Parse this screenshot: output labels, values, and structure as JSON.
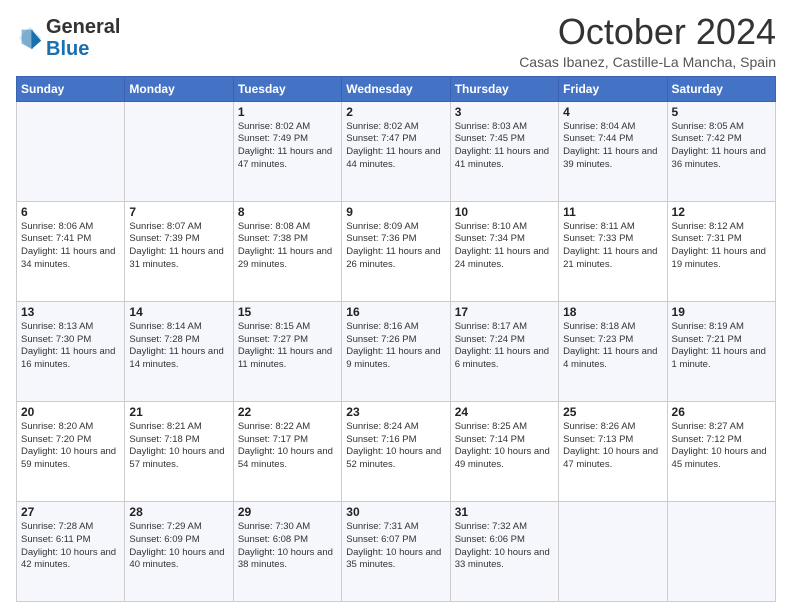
{
  "logo": {
    "line1": "General",
    "line2": "Blue"
  },
  "header": {
    "month": "October 2024",
    "location": "Casas Ibanez, Castille-La Mancha, Spain"
  },
  "weekdays": [
    "Sunday",
    "Monday",
    "Tuesday",
    "Wednesday",
    "Thursday",
    "Friday",
    "Saturday"
  ],
  "weeks": [
    [
      {
        "day": "",
        "sunrise": "",
        "sunset": "",
        "daylight": ""
      },
      {
        "day": "",
        "sunrise": "",
        "sunset": "",
        "daylight": ""
      },
      {
        "day": "1",
        "sunrise": "Sunrise: 8:02 AM",
        "sunset": "Sunset: 7:49 PM",
        "daylight": "Daylight: 11 hours and 47 minutes."
      },
      {
        "day": "2",
        "sunrise": "Sunrise: 8:02 AM",
        "sunset": "Sunset: 7:47 PM",
        "daylight": "Daylight: 11 hours and 44 minutes."
      },
      {
        "day": "3",
        "sunrise": "Sunrise: 8:03 AM",
        "sunset": "Sunset: 7:45 PM",
        "daylight": "Daylight: 11 hours and 41 minutes."
      },
      {
        "day": "4",
        "sunrise": "Sunrise: 8:04 AM",
        "sunset": "Sunset: 7:44 PM",
        "daylight": "Daylight: 11 hours and 39 minutes."
      },
      {
        "day": "5",
        "sunrise": "Sunrise: 8:05 AM",
        "sunset": "Sunset: 7:42 PM",
        "daylight": "Daylight: 11 hours and 36 minutes."
      }
    ],
    [
      {
        "day": "6",
        "sunrise": "Sunrise: 8:06 AM",
        "sunset": "Sunset: 7:41 PM",
        "daylight": "Daylight: 11 hours and 34 minutes."
      },
      {
        "day": "7",
        "sunrise": "Sunrise: 8:07 AM",
        "sunset": "Sunset: 7:39 PM",
        "daylight": "Daylight: 11 hours and 31 minutes."
      },
      {
        "day": "8",
        "sunrise": "Sunrise: 8:08 AM",
        "sunset": "Sunset: 7:38 PM",
        "daylight": "Daylight: 11 hours and 29 minutes."
      },
      {
        "day": "9",
        "sunrise": "Sunrise: 8:09 AM",
        "sunset": "Sunset: 7:36 PM",
        "daylight": "Daylight: 11 hours and 26 minutes."
      },
      {
        "day": "10",
        "sunrise": "Sunrise: 8:10 AM",
        "sunset": "Sunset: 7:34 PM",
        "daylight": "Daylight: 11 hours and 24 minutes."
      },
      {
        "day": "11",
        "sunrise": "Sunrise: 8:11 AM",
        "sunset": "Sunset: 7:33 PM",
        "daylight": "Daylight: 11 hours and 21 minutes."
      },
      {
        "day": "12",
        "sunrise": "Sunrise: 8:12 AM",
        "sunset": "Sunset: 7:31 PM",
        "daylight": "Daylight: 11 hours and 19 minutes."
      }
    ],
    [
      {
        "day": "13",
        "sunrise": "Sunrise: 8:13 AM",
        "sunset": "Sunset: 7:30 PM",
        "daylight": "Daylight: 11 hours and 16 minutes."
      },
      {
        "day": "14",
        "sunrise": "Sunrise: 8:14 AM",
        "sunset": "Sunset: 7:28 PM",
        "daylight": "Daylight: 11 hours and 14 minutes."
      },
      {
        "day": "15",
        "sunrise": "Sunrise: 8:15 AM",
        "sunset": "Sunset: 7:27 PM",
        "daylight": "Daylight: 11 hours and 11 minutes."
      },
      {
        "day": "16",
        "sunrise": "Sunrise: 8:16 AM",
        "sunset": "Sunset: 7:26 PM",
        "daylight": "Daylight: 11 hours and 9 minutes."
      },
      {
        "day": "17",
        "sunrise": "Sunrise: 8:17 AM",
        "sunset": "Sunset: 7:24 PM",
        "daylight": "Daylight: 11 hours and 6 minutes."
      },
      {
        "day": "18",
        "sunrise": "Sunrise: 8:18 AM",
        "sunset": "Sunset: 7:23 PM",
        "daylight": "Daylight: 11 hours and 4 minutes."
      },
      {
        "day": "19",
        "sunrise": "Sunrise: 8:19 AM",
        "sunset": "Sunset: 7:21 PM",
        "daylight": "Daylight: 11 hours and 1 minute."
      }
    ],
    [
      {
        "day": "20",
        "sunrise": "Sunrise: 8:20 AM",
        "sunset": "Sunset: 7:20 PM",
        "daylight": "Daylight: 10 hours and 59 minutes."
      },
      {
        "day": "21",
        "sunrise": "Sunrise: 8:21 AM",
        "sunset": "Sunset: 7:18 PM",
        "daylight": "Daylight: 10 hours and 57 minutes."
      },
      {
        "day": "22",
        "sunrise": "Sunrise: 8:22 AM",
        "sunset": "Sunset: 7:17 PM",
        "daylight": "Daylight: 10 hours and 54 minutes."
      },
      {
        "day": "23",
        "sunrise": "Sunrise: 8:24 AM",
        "sunset": "Sunset: 7:16 PM",
        "daylight": "Daylight: 10 hours and 52 minutes."
      },
      {
        "day": "24",
        "sunrise": "Sunrise: 8:25 AM",
        "sunset": "Sunset: 7:14 PM",
        "daylight": "Daylight: 10 hours and 49 minutes."
      },
      {
        "day": "25",
        "sunrise": "Sunrise: 8:26 AM",
        "sunset": "Sunset: 7:13 PM",
        "daylight": "Daylight: 10 hours and 47 minutes."
      },
      {
        "day": "26",
        "sunrise": "Sunrise: 8:27 AM",
        "sunset": "Sunset: 7:12 PM",
        "daylight": "Daylight: 10 hours and 45 minutes."
      }
    ],
    [
      {
        "day": "27",
        "sunrise": "Sunrise: 7:28 AM",
        "sunset": "Sunset: 6:11 PM",
        "daylight": "Daylight: 10 hours and 42 minutes."
      },
      {
        "day": "28",
        "sunrise": "Sunrise: 7:29 AM",
        "sunset": "Sunset: 6:09 PM",
        "daylight": "Daylight: 10 hours and 40 minutes."
      },
      {
        "day": "29",
        "sunrise": "Sunrise: 7:30 AM",
        "sunset": "Sunset: 6:08 PM",
        "daylight": "Daylight: 10 hours and 38 minutes."
      },
      {
        "day": "30",
        "sunrise": "Sunrise: 7:31 AM",
        "sunset": "Sunset: 6:07 PM",
        "daylight": "Daylight: 10 hours and 35 minutes."
      },
      {
        "day": "31",
        "sunrise": "Sunrise: 7:32 AM",
        "sunset": "Sunset: 6:06 PM",
        "daylight": "Daylight: 10 hours and 33 minutes."
      },
      {
        "day": "",
        "sunrise": "",
        "sunset": "",
        "daylight": ""
      },
      {
        "day": "",
        "sunrise": "",
        "sunset": "",
        "daylight": ""
      }
    ]
  ]
}
